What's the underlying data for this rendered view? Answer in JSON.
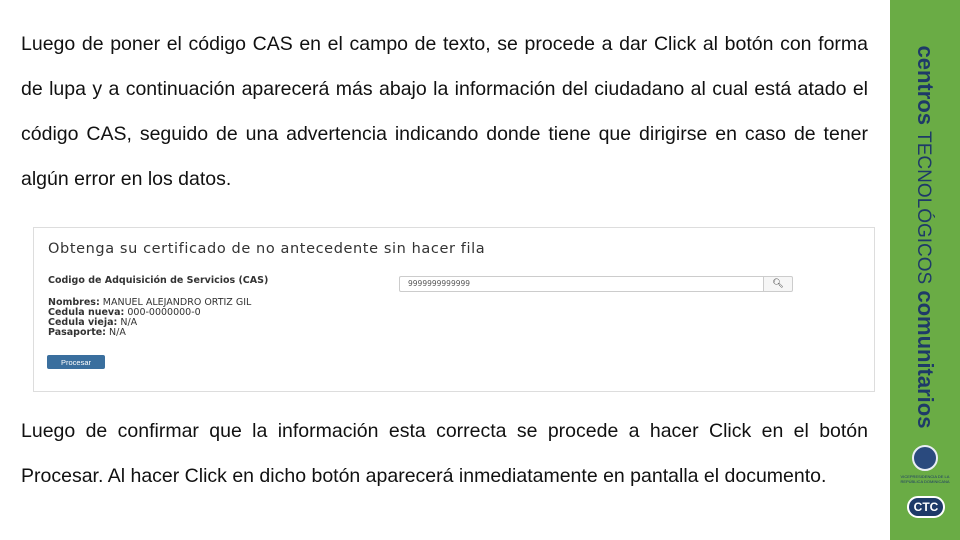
{
  "paragraph1": "Luego de poner el código CAS en el campo de texto, se procede a dar Click al botón con forma de lupa y a continuación aparecerá más abajo la información del ciudadano al cual está atado el código CAS, seguido de una advertencia indicando donde tiene que dirigirse en caso de tener algún error en los datos.",
  "screenshot": {
    "title": "Obtenga su certificado de no antecedente sin hacer fila",
    "cas_label": "Codigo de Adquisición de Servicios (CAS)",
    "cas_value": "9999999999999",
    "search_icon": "search-icon",
    "fields": [
      {
        "label": "Nombres:",
        "value": "MANUEL ALEJANDRO ORTIZ GIL"
      },
      {
        "label": "Cedula nueva:",
        "value": "000-0000000-0"
      },
      {
        "label": "Cedula vieja:",
        "value": "N/A"
      },
      {
        "label": "Pasaporte:",
        "value": "N/A"
      }
    ],
    "process_button": "Procesar",
    "accent": "#3a6f9e"
  },
  "paragraph2": "Luego de confirmar que la información esta correcta se procede a hacer Click en el botón Procesar. Al hacer Click en dicho botón aparecerá inmediatamente en pantalla el documento.",
  "sidebar": {
    "brand_1": "centros",
    "brand_2": "TECNOLÓGICOS",
    "brand_3": "comunitarios",
    "seal_text": "VICEPRESIDENCIA DE LA REPÚBLICA DOMINICANA",
    "logo_text": "CTC",
    "background": "#6aac45",
    "text_color": "#1e3a68"
  }
}
